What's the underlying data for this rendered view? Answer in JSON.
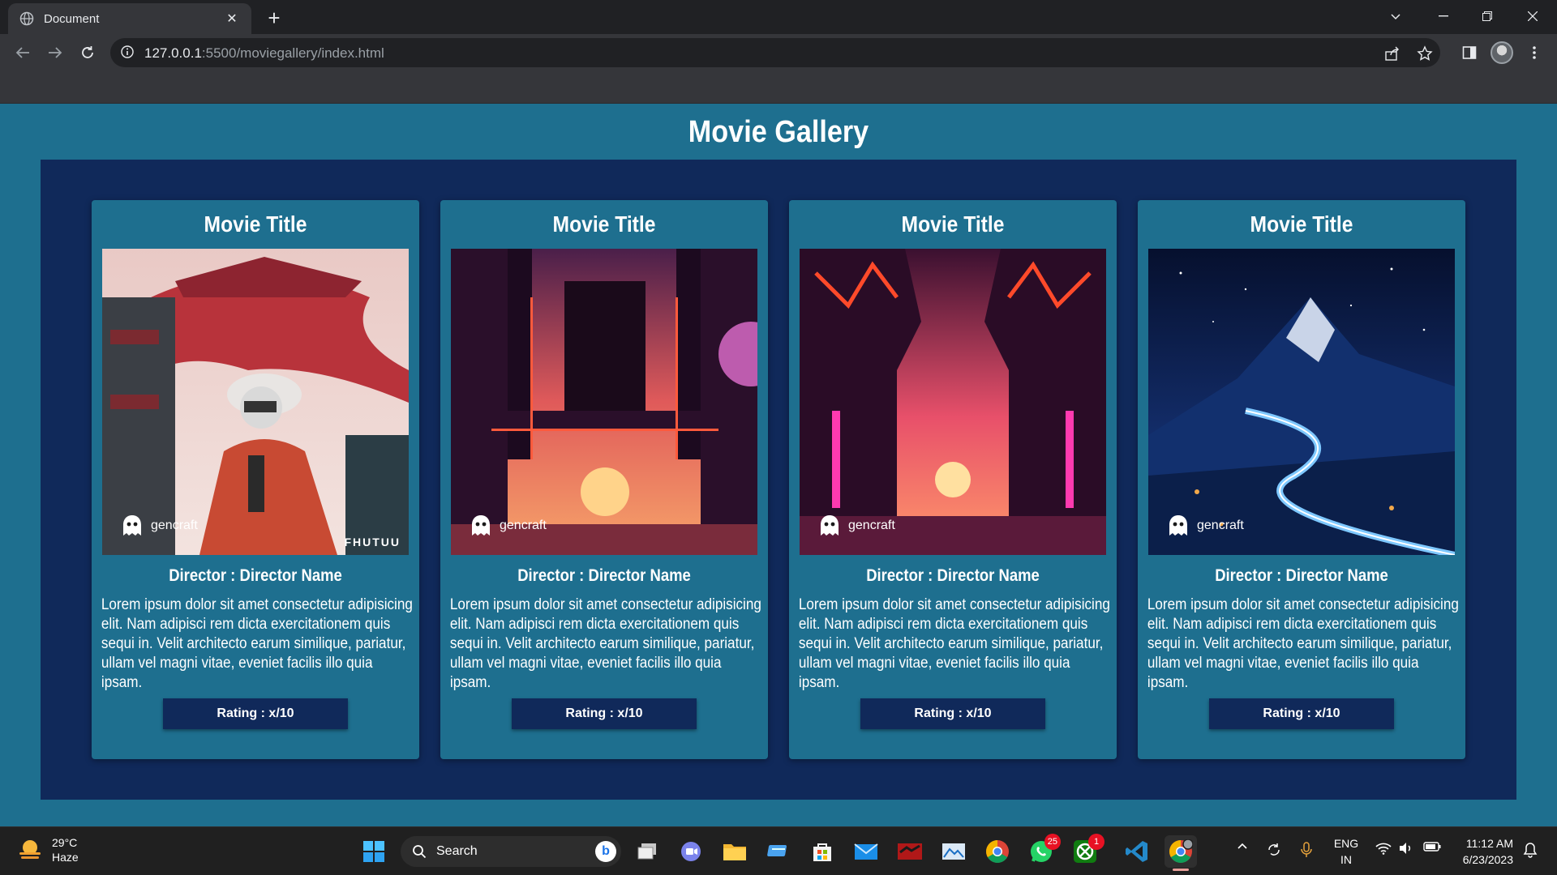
{
  "browser": {
    "tab_title": "Document",
    "url_host": "127.0.0.1",
    "url_rest": ":5500/moviegallery/index.html"
  },
  "page": {
    "heading": "Movie Gallery",
    "cards": [
      {
        "title": "Movie Title",
        "watermark": "gencraft",
        "poster_brand": "FHUTUU",
        "director": "Director : Director Name",
        "description": "Lorem ipsum dolor sit amet consectetur adipisicing elit. Nam adipisci rem dicta exercitationem quis sequi in. Velit architecto earum similique, pariatur, ullam vel magni vitae, eveniet facilis illo quia ipsam.",
        "rating": "Rating : x/10"
      },
      {
        "title": "Movie Title",
        "watermark": "gencraft",
        "director": "Director : Director Name",
        "description": "Lorem ipsum dolor sit amet consectetur adipisicing elit. Nam adipisci rem dicta exercitationem quis sequi in. Velit architecto earum similique, pariatur, ullam vel magni vitae, eveniet facilis illo quia ipsam.",
        "rating": "Rating : x/10"
      },
      {
        "title": "Movie Title",
        "watermark": "gencraft",
        "director": "Director : Director Name",
        "description": "Lorem ipsum dolor sit amet consectetur adipisicing elit. Nam adipisci rem dicta exercitationem quis sequi in. Velit architecto earum similique, pariatur, ullam vel magni vitae, eveniet facilis illo quia ipsam.",
        "rating": "Rating : x/10"
      },
      {
        "title": "Movie Title",
        "watermark": "gencraft",
        "director": "Director : Director Name",
        "description": "Lorem ipsum dolor sit amet consectetur adipisicing elit. Nam adipisci rem dicta exercitationem quis sequi in. Velit architecto earum similique, pariatur, ullam vel magni vitae, eveniet facilis illo quia ipsam.",
        "rating": "Rating : x/10"
      }
    ]
  },
  "taskbar": {
    "weather_temp": "29°C",
    "weather_desc": "Haze",
    "search_label": "Search",
    "whatsapp_badge": "25",
    "xbox_badge": "1",
    "lang_top": "ENG",
    "lang_bottom": "IN",
    "time": "11:12 AM",
    "date": "6/23/2023"
  },
  "colors": {
    "page_bg": "#1e6f8f",
    "gallery_bg": "#10295a",
    "card_bg": "#1e6f8f",
    "rating_bg": "#10295a"
  }
}
